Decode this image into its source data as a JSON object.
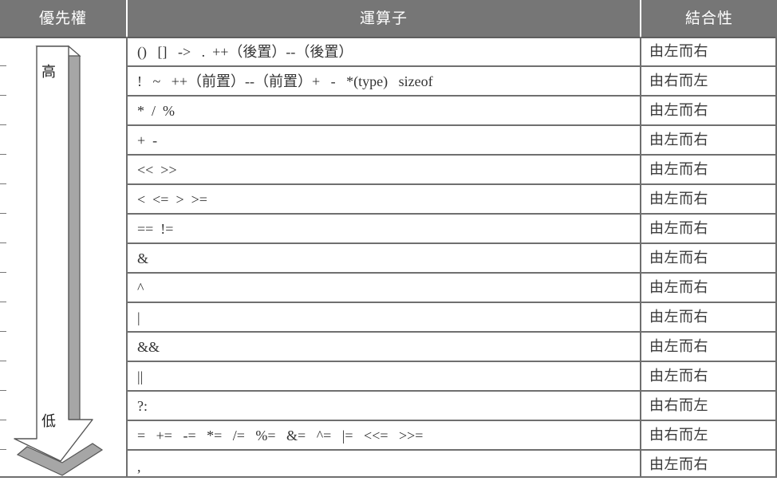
{
  "header": {
    "priority": "優先權",
    "operators": "運算子",
    "associativity": "結合性"
  },
  "arrow": {
    "high": "高",
    "low": "低"
  },
  "rows": [
    {
      "operators": "()   []   ->   .  ++（後置）--（後置）",
      "associativity": "由左而右"
    },
    {
      "operators": "!   ~   ++（前置）--（前置）+   -   *(type)   sizeof",
      "associativity": "由右而左"
    },
    {
      "operators": "*  /  %",
      "associativity": "由左而右"
    },
    {
      "operators": "+  -",
      "associativity": "由左而右"
    },
    {
      "operators": "<<  >>",
      "associativity": "由左而右"
    },
    {
      "operators": "<  <=  >  >=",
      "associativity": "由左而右"
    },
    {
      "operators": "==  !=",
      "associativity": "由左而右"
    },
    {
      "operators": "&",
      "associativity": "由左而右"
    },
    {
      "operators": "^",
      "associativity": "由左而右"
    },
    {
      "operators": "|",
      "associativity": "由左而右"
    },
    {
      "operators": "&&",
      "associativity": "由左而右"
    },
    {
      "operators": "||",
      "associativity": "由左而右"
    },
    {
      "operators": "?:",
      "associativity": "由右而左"
    },
    {
      "operators": "=   +=   -=   *=   /=   %=   &=   ^=   |=   <<=   >>=",
      "associativity": "由右而左"
    },
    {
      "operators": ",",
      "associativity": "由左而右"
    }
  ]
}
